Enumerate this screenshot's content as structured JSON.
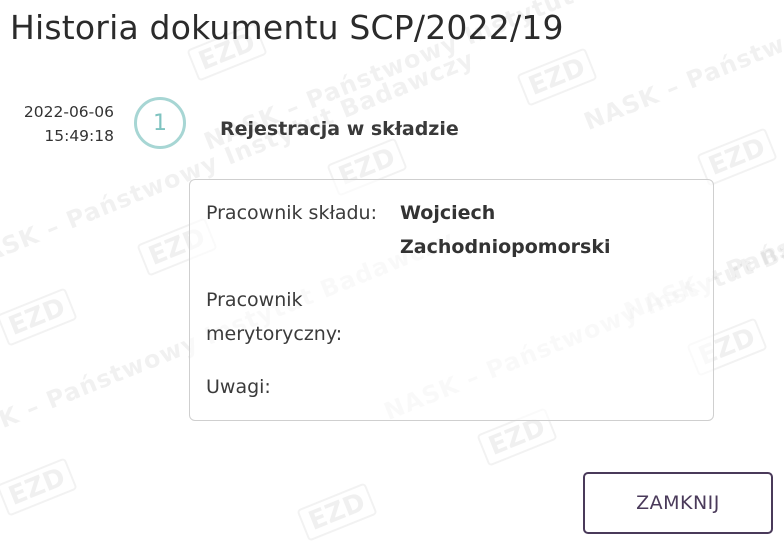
{
  "dialog": {
    "title": "Historia dokumentu SCP/2022/19"
  },
  "timeline": [
    {
      "date": "2022-06-06",
      "time": "15:49:18",
      "step_number": "1",
      "event": "Rejestracja w składzie",
      "details": [
        {
          "label": "Pracownik składu:",
          "value": "Wojciech Zachodniopomorski"
        },
        {
          "label": "Pracownik merytoryczny:",
          "value": ""
        },
        {
          "label": "Uwagi:",
          "value": ""
        }
      ]
    }
  ],
  "footer": {
    "close_label": "ZAMKNIJ"
  },
  "watermark": {
    "text": "NASK – Państwowy Instytut Badawczy",
    "logo": "EZD"
  },
  "colors": {
    "step_circle": "#a7d6d4",
    "button_border": "#4a3a5a",
    "card_border": "#cfcfcf"
  }
}
